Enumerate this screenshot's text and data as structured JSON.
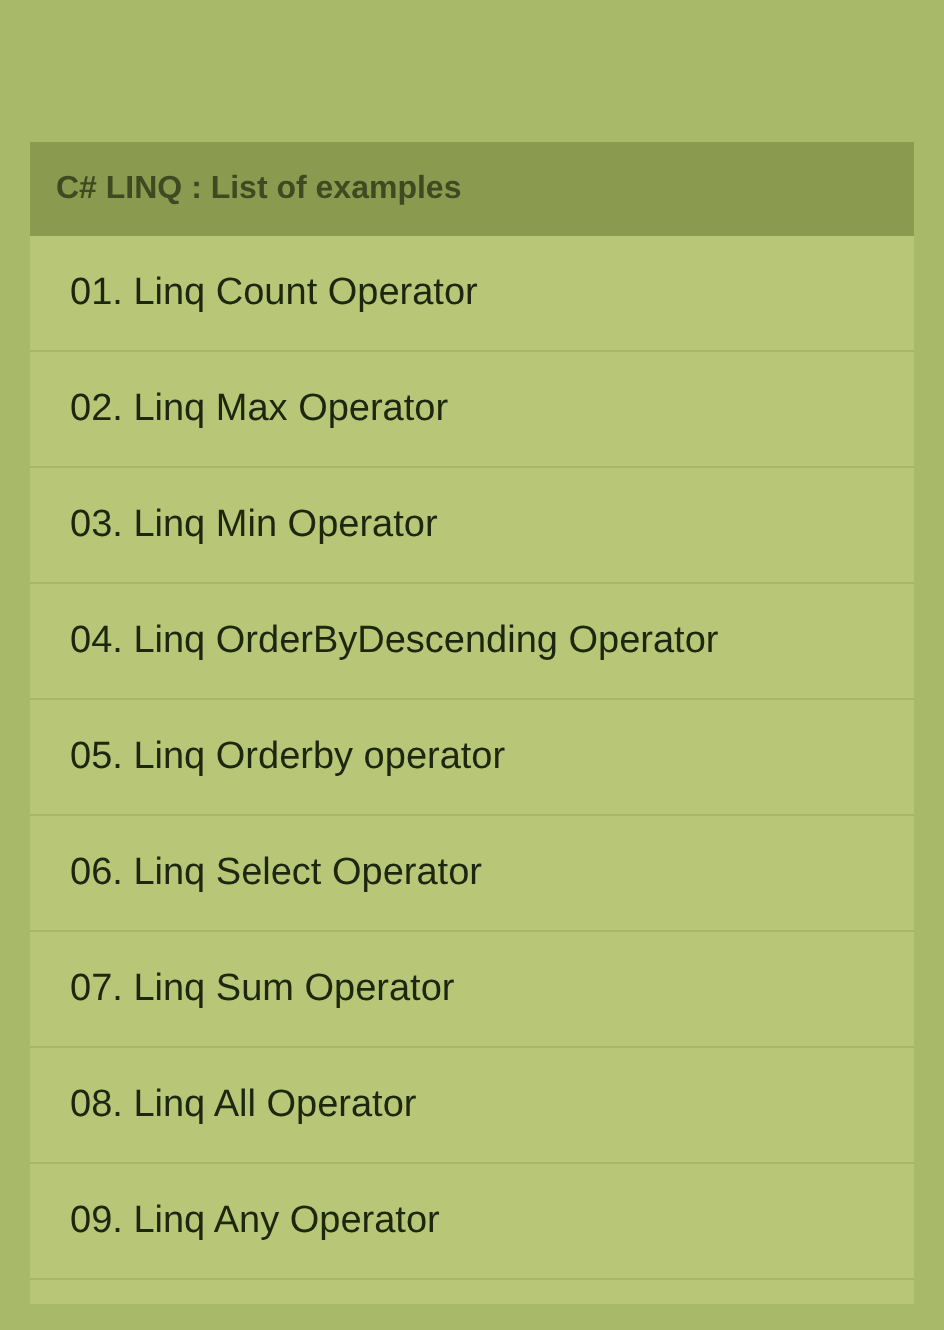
{
  "list": {
    "title": "C# LINQ : List of examples",
    "items": [
      {
        "label": "01. Linq Count Operator"
      },
      {
        "label": "02. Linq Max Operator"
      },
      {
        "label": "03. Linq Min Operator"
      },
      {
        "label": "04. Linq OrderByDescending Operator"
      },
      {
        "label": "05. Linq Orderby operator"
      },
      {
        "label": "06. Linq Select Operator"
      },
      {
        "label": "07. Linq Sum Operator"
      },
      {
        "label": "08. Linq All Operator"
      },
      {
        "label": "09. Linq Any Operator"
      }
    ]
  }
}
